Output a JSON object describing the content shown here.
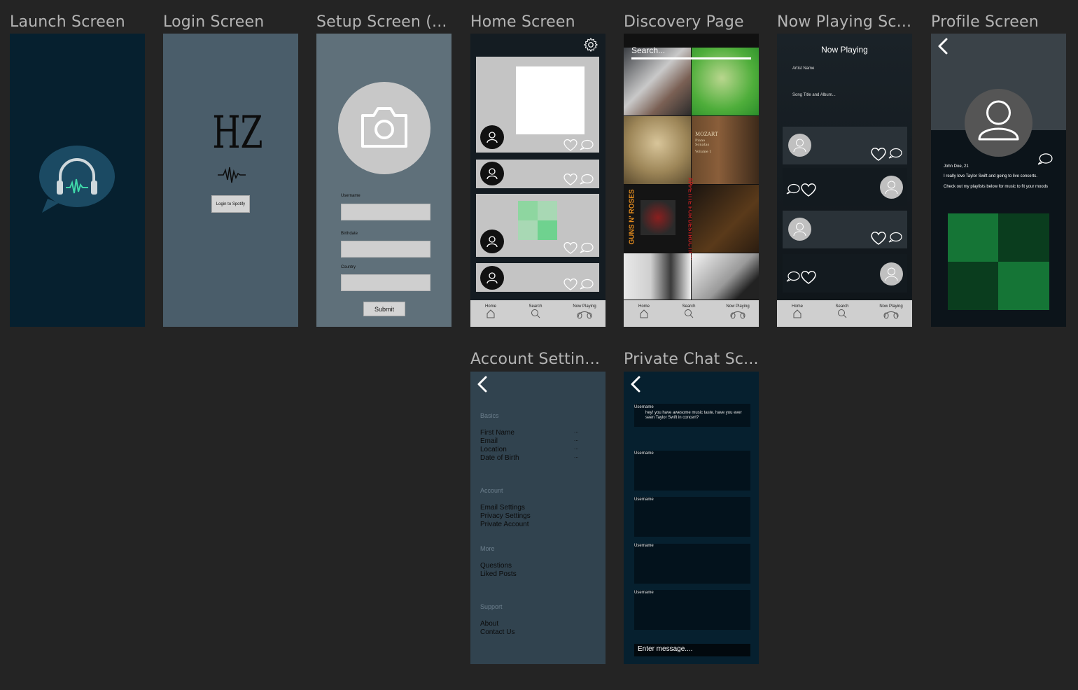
{
  "frames": {
    "launch": {
      "title": "Launch Screen"
    },
    "login": {
      "title": "Login Screen",
      "logo_text": "HZ",
      "login_button": "Login to Spotify"
    },
    "setup": {
      "title": "Setup Screen (...",
      "username_label": "Username",
      "birthdate_label": "Birthdate",
      "country_label": "Country",
      "submit_button": "Submit"
    },
    "home": {
      "title": "Home Screen"
    },
    "discovery": {
      "title": "Discovery Page",
      "search_placeholder": "Search...",
      "album_text_1": "MOZART",
      "album_text_2": "Piano Sonatas",
      "album_text_3": "Volume 1",
      "album_text_4": "GUNS N' ROSES",
      "album_text_5": "APPETITE FOR DESTRUCTION"
    },
    "now_playing": {
      "title": "Now Playing Sc...",
      "header": "Now Playing",
      "artist": "Artist Name",
      "song": "Song Title and Album..."
    },
    "profile": {
      "title": "Profile Screen",
      "name": "John Doe, 21",
      "bio_1": "I really love Taylor Swift and going to live concerts.",
      "bio_2": "Check out my playlists below for music to fit your moods"
    },
    "account": {
      "title": "Account Settin...",
      "sections": [
        {
          "heading": "Basics",
          "items": [
            "First Name",
            "Email",
            "Location",
            "Date of Birth"
          ]
        },
        {
          "heading": "Account",
          "items": [
            "Email Settings",
            "Privacy Settings",
            "Private Account"
          ]
        },
        {
          "heading": "More",
          "items": [
            "Questions",
            "Liked Posts"
          ]
        },
        {
          "heading": "Support",
          "items": [
            "About",
            "Contact Us"
          ]
        }
      ],
      "ellipsis": "..."
    },
    "chat": {
      "title": "Private Chat Sc...",
      "user_label": "Username",
      "first_message": "hey! you have awesome music taste. have you ever seen Taylor Swift in concert?",
      "input_placeholder": "Enter message...."
    }
  },
  "nav": {
    "home": "Home",
    "search": "Search",
    "now_playing": "Now Playing"
  },
  "colors": {
    "canvas": "#242424",
    "launch_bg": "#06202f",
    "login_bg": "#4a5d6a",
    "setup_bg": "#5f707a",
    "dark_screen": "#111a20",
    "accent_green": "#1f8a3f",
    "settings_bg": "#31434f"
  }
}
